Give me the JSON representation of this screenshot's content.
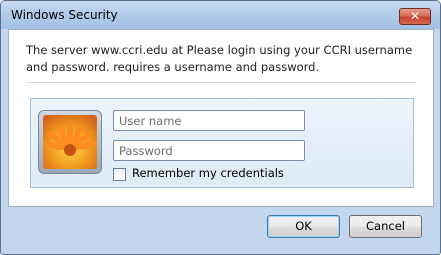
{
  "window": {
    "title": "Windows Security",
    "close_glyph": "✕"
  },
  "message": {
    "text": "The server www.ccri.edu at Please login using your CCRI username and password. requires a username and password."
  },
  "credentials": {
    "username_placeholder": "User name",
    "password_placeholder": "Password",
    "remember_label": "Remember my credentials",
    "remember_checked": false
  },
  "buttons": {
    "ok_label": "OK",
    "cancel_label": "Cancel"
  },
  "icons": {
    "close": "close-icon",
    "user_tile": "flower-user-tile-icon"
  }
}
